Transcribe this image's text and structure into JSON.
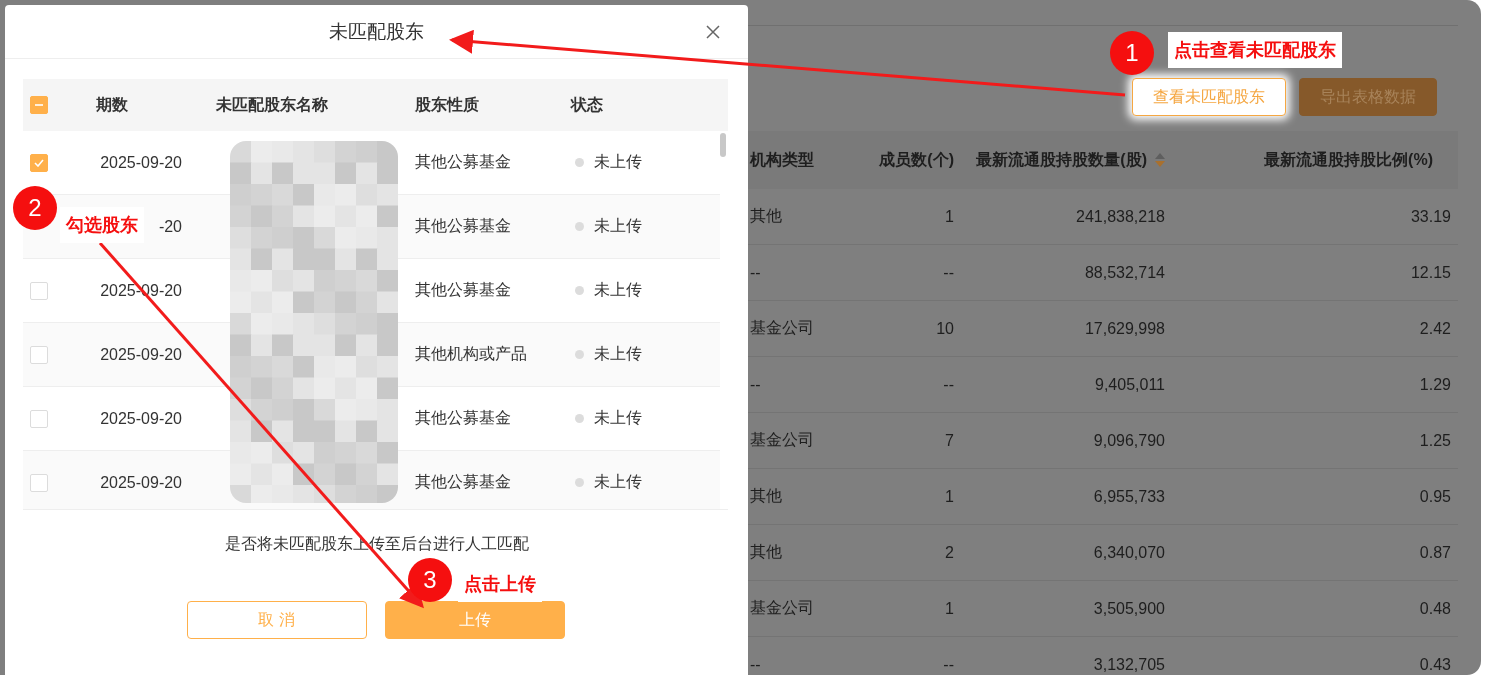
{
  "background_page": {
    "buttons": [
      {
        "label": "查看未匹配股东",
        "highlighted": true
      },
      {
        "label": "导出表格数据",
        "highlighted": false
      }
    ],
    "table": {
      "columns": [
        {
          "label": "机构类型",
          "sorted": false
        },
        {
          "label": "成员数(个)",
          "sorted": false
        },
        {
          "label": "最新流通股持股数量(股)",
          "sorted": true
        },
        {
          "label": "最新流通股持股比例(%)",
          "sorted": false
        }
      ],
      "rows": [
        [
          "其他",
          "1",
          "241,838,218",
          "33.19"
        ],
        [
          "--",
          "--",
          "88,532,714",
          "12.15"
        ],
        [
          "基金公司",
          "10",
          "17,629,998",
          "2.42"
        ],
        [
          "--",
          "--",
          "9,405,011",
          "1.29"
        ],
        [
          "基金公司",
          "7",
          "9,096,790",
          "1.25"
        ],
        [
          "其他",
          "1",
          "6,955,733",
          "0.95"
        ],
        [
          "其他",
          "2",
          "6,340,070",
          "0.87"
        ],
        [
          "基金公司",
          "1",
          "3,505,900",
          "0.48"
        ],
        [
          "--",
          "--",
          "3,132,705",
          "0.43"
        ]
      ]
    }
  },
  "dialog": {
    "title": "未匹配股东",
    "table": {
      "header_checkbox": {
        "indeterminate": true
      },
      "columns": [
        "期数",
        "未匹配股东名称",
        "股东性质",
        "状态"
      ],
      "rows": [
        {
          "checked": true,
          "period": "2025-09-20",
          "nature": "其他公募基金",
          "status": "未上传"
        },
        {
          "period": "-20",
          "nature": "其他公募基金",
          "status": "未上传"
        },
        {
          "checked": false,
          "period": "2025-09-20",
          "nature": "其他公募基金",
          "status": "未上传"
        },
        {
          "checked": false,
          "period": "2025-09-20",
          "nature": "其他机构或产品",
          "status": "未上传"
        },
        {
          "checked": false,
          "period": "2025-09-20",
          "nature": "其他公募基金",
          "status": "未上传"
        },
        {
          "checked": false,
          "period": "2025-09-20",
          "nature": "其他公募基金",
          "status": "未上传"
        }
      ]
    },
    "prompt": "是否将未匹配股东上传至后台进行人工匹配",
    "buttons": [
      {
        "label": "取 消",
        "kind": "secondary"
      },
      {
        "label": "上传",
        "kind": "primary"
      }
    ]
  },
  "annotations": [
    {
      "number": "1",
      "label": "点击查看未匹配股东"
    },
    {
      "number": "2",
      "label": "勾选股东"
    },
    {
      "number": "3",
      "label": "点击上传"
    }
  ]
}
